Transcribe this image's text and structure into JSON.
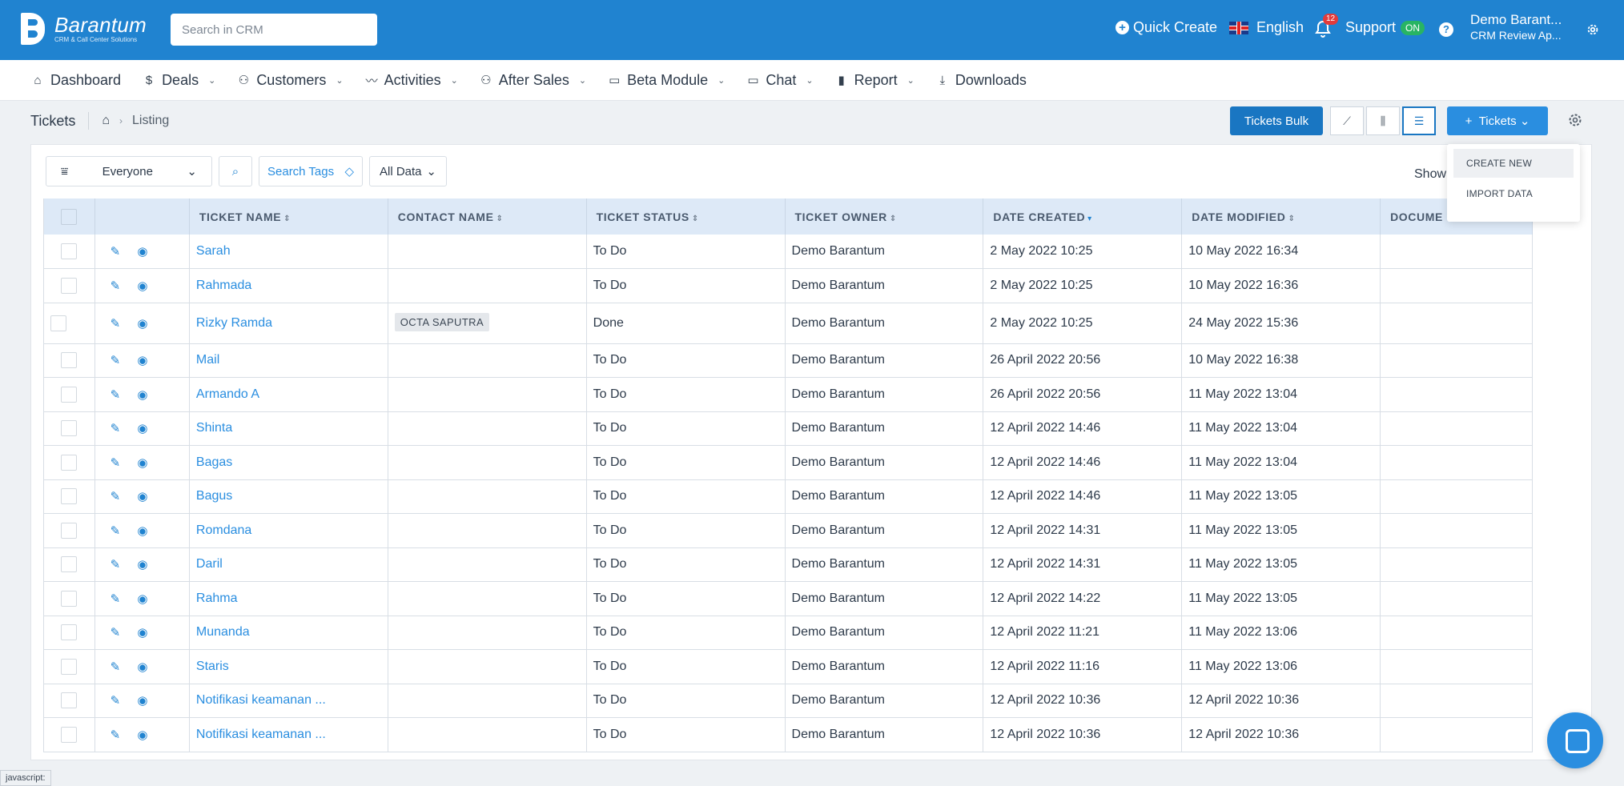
{
  "app": {
    "name": "Barantum",
    "tagline": "CRM & Call Center Solutions",
    "search_placeholder": "Search in CRM"
  },
  "topbar": {
    "quick_create": "Quick Create",
    "language": "English",
    "notification_count": "12",
    "support": "Support",
    "support_status": "ON",
    "user_name": "Demo Barant...",
    "user_sub": "CRM Review Ap..."
  },
  "nav": {
    "items": [
      {
        "label": "Dashboard",
        "icon": "home-icon"
      },
      {
        "label": "Deals",
        "icon": "dollar-icon"
      },
      {
        "label": "Customers",
        "icon": "users-icon"
      },
      {
        "label": "Activities",
        "icon": "activity-icon"
      },
      {
        "label": "After Sales",
        "icon": "users-icon"
      },
      {
        "label": "Beta Module",
        "icon": "folder-icon"
      },
      {
        "label": "Chat",
        "icon": "folder-icon"
      },
      {
        "label": "Report",
        "icon": "bar-chart-icon"
      },
      {
        "label": "Downloads",
        "icon": "download-icon"
      }
    ]
  },
  "breadcrumb": {
    "module": "Tickets",
    "leaf": "Listing"
  },
  "toolbar": {
    "bulk_label": "Tickets Bulk",
    "tickets_label": "Tickets"
  },
  "dropdown": {
    "create_new": "CREATE NEW",
    "import_data": "IMPORT DATA"
  },
  "filters": {
    "owner": "Everyone",
    "search_tags": "Search Tags",
    "data_scope": "All Data",
    "show_label": "Show"
  },
  "table": {
    "columns": [
      "TICKET NAME",
      "CONTACT NAME",
      "TICKET STATUS",
      "TICKET OWNER",
      "DATE CREATED",
      "DATE MODIFIED",
      "DOCUME"
    ],
    "rows": [
      {
        "name": "Sarah",
        "contact": "",
        "status": "To Do",
        "owner": "Demo Barantum",
        "created": "2 May 2022 10:25",
        "modified": "10 May 2022 16:34"
      },
      {
        "name": "Rahmada",
        "contact": "",
        "status": "To Do",
        "owner": "Demo Barantum",
        "created": "2 May 2022 10:25",
        "modified": "10 May 2022 16:36"
      },
      {
        "name": "Rizky Ramda",
        "contact": "OCTA SAPUTRA",
        "status": "Done",
        "owner": "Demo Barantum",
        "created": "2 May 2022 10:25",
        "modified": "24 May 2022 15:36"
      },
      {
        "name": "Mail",
        "contact": "",
        "status": "To Do",
        "owner": "Demo Barantum",
        "created": "26 April 2022 20:56",
        "modified": "10 May 2022 16:38"
      },
      {
        "name": "Armando A",
        "contact": "",
        "status": "To Do",
        "owner": "Demo Barantum",
        "created": "26 April 2022 20:56",
        "modified": "11 May 2022 13:04"
      },
      {
        "name": "Shinta",
        "contact": "",
        "status": "To Do",
        "owner": "Demo Barantum",
        "created": "12 April 2022 14:46",
        "modified": "11 May 2022 13:04"
      },
      {
        "name": "Bagas",
        "contact": "",
        "status": "To Do",
        "owner": "Demo Barantum",
        "created": "12 April 2022 14:46",
        "modified": "11 May 2022 13:04"
      },
      {
        "name": "Bagus",
        "contact": "",
        "status": "To Do",
        "owner": "Demo Barantum",
        "created": "12 April 2022 14:46",
        "modified": "11 May 2022 13:05"
      },
      {
        "name": "Romdana",
        "contact": "",
        "status": "To Do",
        "owner": "Demo Barantum",
        "created": "12 April 2022 14:31",
        "modified": "11 May 2022 13:05"
      },
      {
        "name": "Daril",
        "contact": "",
        "status": "To Do",
        "owner": "Demo Barantum",
        "created": "12 April 2022 14:31",
        "modified": "11 May 2022 13:05"
      },
      {
        "name": "Rahma",
        "contact": "",
        "status": "To Do",
        "owner": "Demo Barantum",
        "created": "12 April 2022 14:22",
        "modified": "11 May 2022 13:05"
      },
      {
        "name": "Munanda",
        "contact": "",
        "status": "To Do",
        "owner": "Demo Barantum",
        "created": "12 April 2022 11:21",
        "modified": "11 May 2022 13:06"
      },
      {
        "name": "Staris",
        "contact": "",
        "status": "To Do",
        "owner": "Demo Barantum",
        "created": "12 April 2022 11:16",
        "modified": "11 May 2022 13:06"
      },
      {
        "name": "Notifikasi keamanan ...",
        "contact": "",
        "status": "To Do",
        "owner": "Demo Barantum",
        "created": "12 April 2022 10:36",
        "modified": "12 April 2022 10:36"
      },
      {
        "name": "Notifikasi keamanan ...",
        "contact": "",
        "status": "To Do",
        "owner": "Demo Barantum",
        "created": "12 April 2022 10:36",
        "modified": "12 April 2022 10:36"
      }
    ]
  },
  "statusbar": "javascript:",
  "colors": {
    "brand": "#2083d0",
    "link": "#2a8ee0",
    "header_bg": "#dde9f7"
  }
}
